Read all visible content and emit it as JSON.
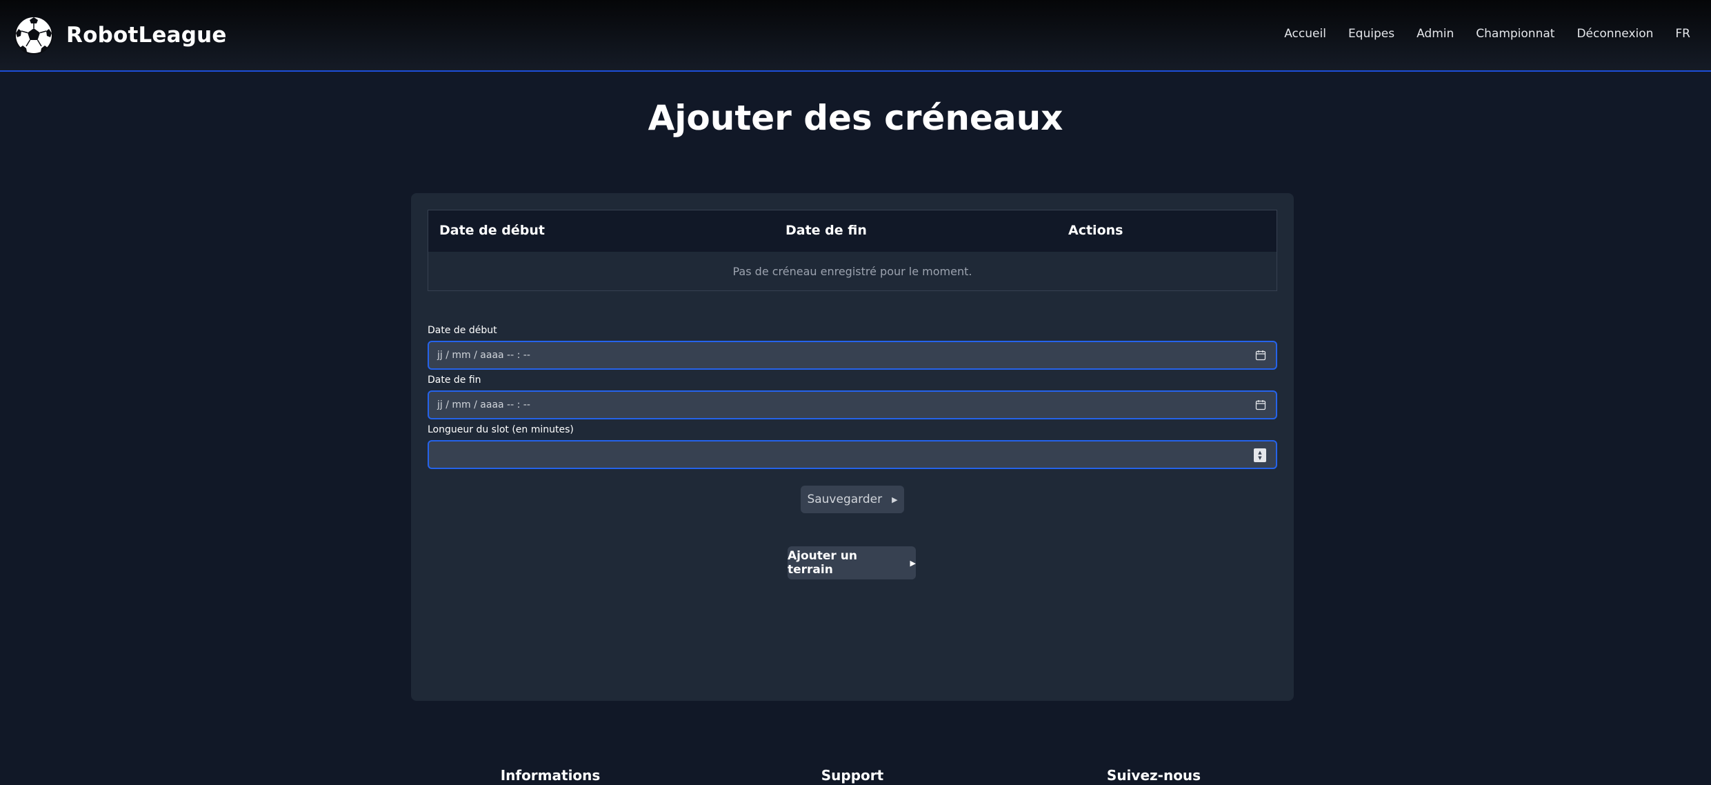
{
  "header": {
    "brand": "RobotLeague",
    "logo_icon": "soccer-ball-icon",
    "nav": [
      "Accueil",
      "Equipes",
      "Admin",
      "Championnat",
      "Déconnexion",
      "FR"
    ]
  },
  "page": {
    "title": "Ajouter des créneaux"
  },
  "table": {
    "columns": [
      "Date de début",
      "Date de fin",
      "Actions"
    ],
    "empty_message": "Pas de créneau enregistré pour le moment."
  },
  "form": {
    "start_label": "Date de début",
    "start_placeholder": "jj / mm / aaaa  -- : --",
    "end_label": "Date de fin",
    "end_placeholder": "jj / mm / aaaa  -- : --",
    "slot_label": "Longueur du slot (en minutes)",
    "slot_value": "",
    "save_label": "Sauvegarder",
    "add_field_label": "Ajouter un terrain"
  },
  "footer": {
    "headings": [
      "Informations",
      "Support",
      "Suivez-nous"
    ]
  },
  "colors": {
    "background": "#111827",
    "card": "#1f2937",
    "accent": "#2563eb",
    "button": "#374151"
  }
}
